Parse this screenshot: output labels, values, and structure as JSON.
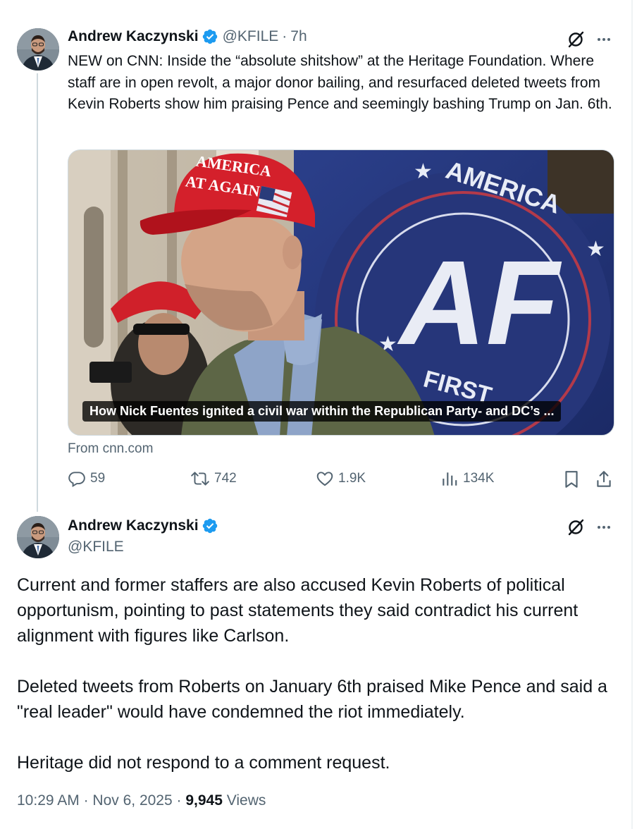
{
  "tweet1": {
    "author": {
      "name": "Andrew Kaczynski",
      "handle": "@KFILE",
      "verified": true
    },
    "age": "7h",
    "separator": "·",
    "text": "NEW on CNN: Inside the “absolute shitshow” at the Heritage Foundation. Where staff are in open revolt, a major donor bailing, and resurfaced deleted tweets from Kevin Roberts show him praising Pence and seemingly bashing Trump on Jan. 6th.",
    "card": {
      "title": "How Nick Fuentes ignited a civil war within the Republican Party- and DC’s ...",
      "source": "From cnn.com",
      "image_text": {
        "cap_line1": "AMERICA",
        "cap_line2": "AT AGAIN",
        "flag_letters": "AF",
        "flag_top": "AMERICA",
        "flag_bottom": "FIRST"
      }
    },
    "actions": {
      "replies": "59",
      "reposts": "742",
      "likes": "1.9K",
      "views": "134K"
    }
  },
  "tweet2": {
    "author": {
      "name": "Andrew Kaczynski",
      "handle": "@KFILE",
      "verified": true
    },
    "paragraphs": [
      "Current and former staffers are also accused Kevin Roberts of political opportunism, pointing to past statements they said contradict his current alignment with figures like Carlson.",
      "Deleted  tweets from Roberts on January 6th praised Mike Pence and said a \"real leader\" would have condemned the riot immediately.",
      "Heritage did not respond to a comment request."
    ],
    "time": "10:29 AM",
    "date": "Nov 6, 2025",
    "views_count": "9,945",
    "views_label": "Views",
    "separator": "·"
  },
  "colors": {
    "text_primary": "#0f1419",
    "text_secondary": "#536471",
    "verified_blue": "#1d9bf0",
    "border": "#cfd9de"
  },
  "icons": [
    "verified-badge-icon",
    "grok-icon",
    "more-icon",
    "reply-icon",
    "repost-icon",
    "like-icon",
    "views-icon",
    "bookmark-icon",
    "share-icon"
  ]
}
